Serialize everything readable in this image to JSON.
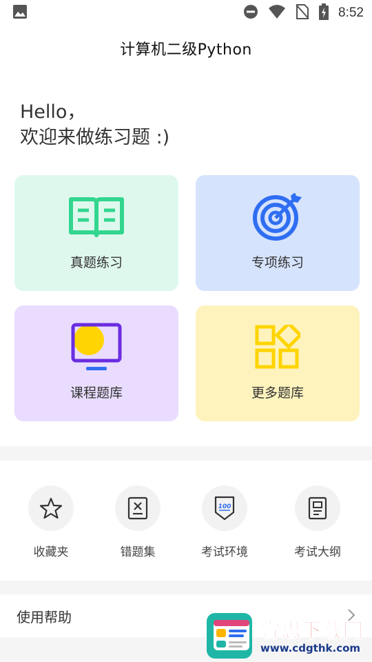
{
  "status_bar": {
    "time": "8:52",
    "icons": [
      "image-icon",
      "do-not-disturb-icon",
      "wifi-icon",
      "no-sim-icon",
      "battery-icon"
    ]
  },
  "header": {
    "title": "计算机二级Python"
  },
  "greeting": {
    "line1": "Hello，",
    "line2": "欢迎来做练习题 :)"
  },
  "cards": [
    {
      "label": "真题练习",
      "icon": "open-book-icon",
      "bg": "#dff8ee",
      "accent": "#33d68f"
    },
    {
      "label": "专项练习",
      "icon": "target-icon",
      "bg": "#d6e3fd",
      "accent": "#2f6ef2"
    },
    {
      "label": "课程题库",
      "icon": "monitor-icon",
      "bg": "#e9dcfe",
      "accent": "#6a2de0"
    },
    {
      "label": "更多题库",
      "icon": "apps-grid-icon",
      "bg": "#fef3bd",
      "accent": "#ffd400"
    }
  ],
  "shortcuts": [
    {
      "label": "收藏夹",
      "icon": "star-icon"
    },
    {
      "label": "错题集",
      "icon": "wrong-answers-icon"
    },
    {
      "label": "考试环境",
      "icon": "score-100-icon"
    },
    {
      "label": "考试大纲",
      "icon": "syllabus-icon"
    }
  ],
  "help": {
    "label": "使用帮助",
    "icon": "chevron-right-icon"
  },
  "watermark": {
    "title": "睿思下载网",
    "url": "www.cdgthk.com"
  }
}
